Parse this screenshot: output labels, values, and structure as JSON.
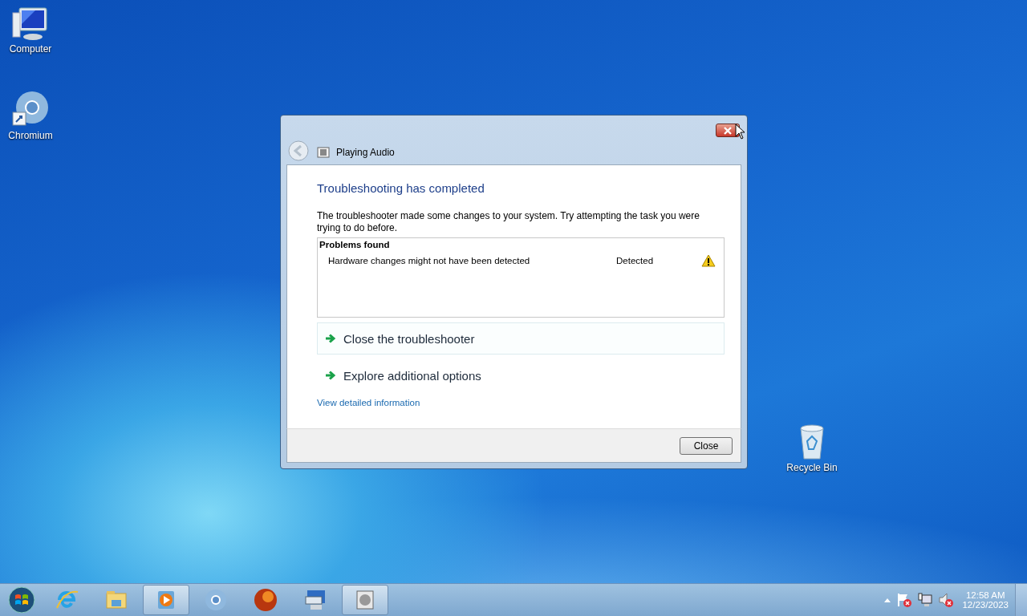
{
  "desktop_icons": [
    {
      "kind": "computer",
      "label": "Computer"
    },
    {
      "kind": "chromium",
      "label": "Chromium"
    },
    {
      "kind": "recycle",
      "label": "Recycle Bin"
    }
  ],
  "window": {
    "title": "Playing Audio",
    "heading": "Troubleshooting has completed",
    "description": "The troubleshooter made some changes to your system. Try attempting the task you were trying to do before.",
    "problems": {
      "title": "Problems found",
      "rows": [
        {
          "problem": "Hardware changes might not have been detected",
          "status": "Detected"
        }
      ]
    },
    "options": [
      {
        "label": "Close the troubleshooter",
        "selected": true
      },
      {
        "label": "Explore additional options",
        "selected": false
      }
    ],
    "link": "View detailed information",
    "button": "Close"
  },
  "taskbar": {
    "items": [
      {
        "kind": "ie",
        "selected": false
      },
      {
        "kind": "explorer",
        "selected": false
      },
      {
        "kind": "media",
        "selected": true
      },
      {
        "kind": "chromium",
        "selected": false
      },
      {
        "kind": "firefox",
        "selected": false
      },
      {
        "kind": "osk",
        "selected": false
      },
      {
        "kind": "troubleshooter",
        "selected": true
      }
    ],
    "time": "12:58 AM",
    "date": "12/23/2023"
  }
}
